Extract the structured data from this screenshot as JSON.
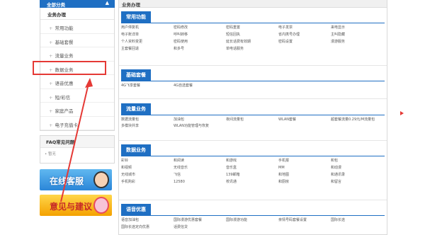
{
  "sidebar": {
    "top_label": "全部分类",
    "top_caret": "▲",
    "section_title": "业务办理",
    "items": [
      {
        "label": "常用功能"
      },
      {
        "label": "基础套餐"
      },
      {
        "label": "流量业务"
      },
      {
        "label": "数据业务"
      },
      {
        "label": "语音优惠"
      },
      {
        "label": "短/彩信"
      },
      {
        "label": "家庭产品"
      },
      {
        "label": "电子充值卡"
      }
    ],
    "faq_title": "FAQ常见问题",
    "faq_item": "暂无",
    "banner_cs": "在线客服",
    "banner_feedback": "意见与建议"
  },
  "main": {
    "header": "业务办理",
    "sections": {
      "common": {
        "title": "常用功能",
        "rows": [
          [
            "用户停复机",
            "密码修改",
            "密码重置",
            "电子发票",
            "来电显示"
          ],
          [
            "电子账详单",
            "呼叫转移",
            "短信回执",
            "省内携号办理",
            "主叫隐藏"
          ],
          [
            "个人资料变更",
            "密码使用",
            "延长话费有效期",
            "密码设置",
            "漫游服务"
          ],
          [
            "主套餐回退",
            "和多号",
            "单电话服务",
            "",
            ""
          ]
        ]
      },
      "basic": {
        "title": "基础套餐",
        "rows": [
          [
            "4G飞享套餐",
            "4G自选套餐",
            "",
            "",
            ""
          ]
        ]
      },
      "flow": {
        "title": "流量业务",
        "rows": [
          [
            "数据流量包",
            "加油包",
            "夜间流量包",
            "WLAN套餐",
            "超套餐流量0.29元/M流量包"
          ],
          [
            "多模块共享",
            "WLAN功能管理与恢复",
            "",
            "",
            ""
          ]
        ]
      },
      "data": {
        "title": "数据业务",
        "rows": [
          [
            "彩铃",
            "和阅读",
            "和游戏",
            "手机报",
            "和包"
          ],
          [
            "和视频",
            "无线音乐",
            "音乐盒",
            "MM",
            "和动漫"
          ],
          [
            "无线城市",
            "飞信",
            "139邮箱",
            "和地图",
            "和通讯录"
          ],
          [
            "手机购彩",
            "12580",
            "校讯通",
            "和厨房",
            "和留言"
          ]
        ]
      },
      "voice": {
        "title": "语音优惠",
        "rows": [
          [
            "语音加油包",
            "国际漫游优惠套餐",
            "国际漫游功能",
            "亲情号码套餐设置",
            "国际长途"
          ],
          [
            "国际长途定向优惠",
            "话费信贷",
            "",
            "",
            ""
          ]
        ]
      }
    }
  },
  "colors": {
    "accent": "#1f6fc3",
    "highlight": "#e53935",
    "cs_banner": "#2b86d8",
    "feedback_banner": "#f4a100"
  }
}
